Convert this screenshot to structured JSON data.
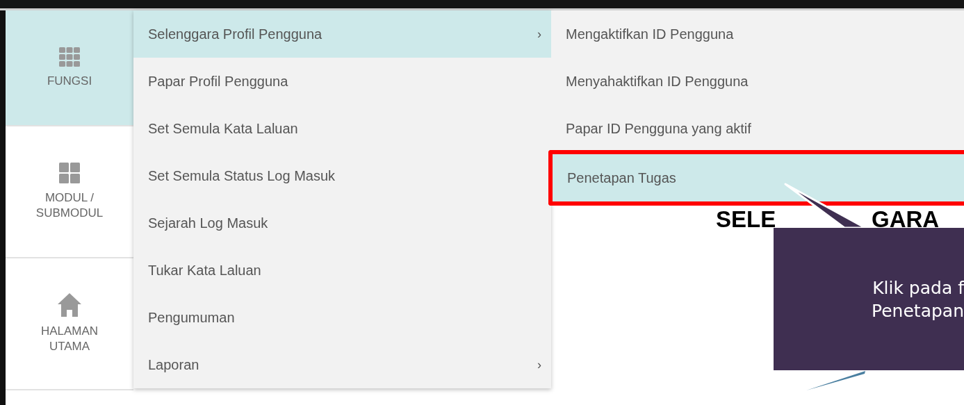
{
  "sidebar": {
    "items": [
      {
        "label": [
          "FUNGSI"
        ],
        "kind": "functions",
        "selected": true
      },
      {
        "label": [
          "MODUL /",
          "SUBMODUL"
        ],
        "kind": "modules",
        "selected": false
      },
      {
        "label": [
          "HALAMAN",
          "UTAMA"
        ],
        "kind": "home",
        "selected": false
      }
    ]
  },
  "menu": {
    "items": [
      {
        "label": "Selenggara Profil Pengguna",
        "submenu": true,
        "selected": true,
        "arrow": "›"
      },
      {
        "label": "Papar Profil Pengguna",
        "submenu": false,
        "selected": false
      },
      {
        "label": "Set Semula Kata Laluan",
        "submenu": false,
        "selected": false
      },
      {
        "label": "Set Semula Status Log Masuk",
        "submenu": false,
        "selected": false
      },
      {
        "label": "Sejarah Log Masuk",
        "submenu": false,
        "selected": false
      },
      {
        "label": "Tukar Kata Laluan",
        "submenu": false,
        "selected": false
      },
      {
        "label": "Pengumuman",
        "submenu": false,
        "selected": false
      },
      {
        "label": "Laporan",
        "submenu": true,
        "selected": false,
        "arrow": "›"
      }
    ]
  },
  "submenu": {
    "items": [
      {
        "label": "Mengaktifkan ID Pengguna",
        "selected": false,
        "highlighted": false
      },
      {
        "label": "Menyahaktifkan ID Pengguna",
        "selected": false,
        "highlighted": false
      },
      {
        "label": "Papar ID Pengguna yang aktif",
        "selected": false,
        "highlighted": false
      },
      {
        "label": "Penetapan Tugas",
        "selected": true,
        "highlighted": true
      }
    ]
  },
  "page_heading": [
    "SELE",
    "GARA"
  ],
  "callout": {
    "lines": [
      "Klik pada f",
      "Penetapan"
    ]
  }
}
